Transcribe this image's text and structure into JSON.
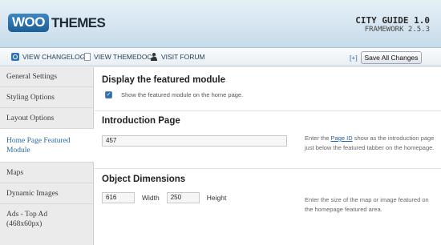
{
  "header": {
    "logo_woo": "WOO",
    "logo_themes": "THEMES",
    "theme_name": "CITY GUIDE 1.0",
    "framework": "FRAMEWORK 2.5.3"
  },
  "toolbar": {
    "changelog": "VIEW CHANGELOG",
    "themedocs": "VIEW THEMEDOCS",
    "forum": "VISIT FORUM",
    "expand": "[+]",
    "save_label": "Save All Changes"
  },
  "sidebar": {
    "items": [
      {
        "label": "General Settings"
      },
      {
        "label": "Styling Options"
      },
      {
        "label": "Layout Options"
      },
      {
        "label": "Home Page Featured Module"
      },
      {
        "label": "Maps"
      },
      {
        "label": "Dynamic Images"
      },
      {
        "label": "Ads - Top Ad (468x60px)"
      }
    ],
    "active_index": 3
  },
  "main": {
    "featured": {
      "title": "Display the featured module",
      "checkbox_checked": true,
      "checkbox_label": "Show the featured module on the home page."
    },
    "intro": {
      "title": "Introduction Page",
      "value": "457",
      "desc_before": "Enter the ",
      "desc_link": "Page ID",
      "desc_after": " show as the introduction page just below the featured tabber on the homepage."
    },
    "dimensions": {
      "title": "Object Dimensions",
      "width_value": "616",
      "width_label": "Width",
      "height_value": "250",
      "height_label": "Height",
      "desc": "Enter the size of the map or image featured on the homepage featured area."
    }
  },
  "colors": {
    "accent": "#2d6fb3",
    "header_bg": "#c7dbea",
    "sidebar_bg": "#ebebeb"
  }
}
